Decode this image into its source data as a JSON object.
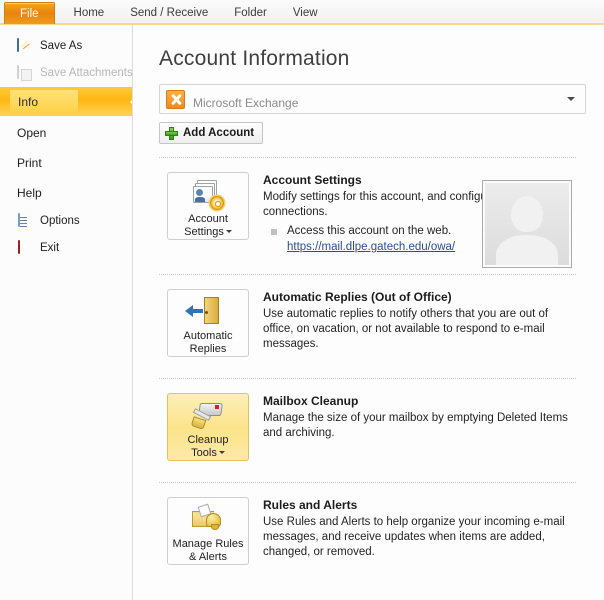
{
  "window": {
    "title": "Account Information"
  },
  "ribbon": {
    "tabs": [
      {
        "label": "File",
        "active": true
      },
      {
        "label": "Home",
        "active": false
      },
      {
        "label": "Send / Receive",
        "active": false
      },
      {
        "label": "Folder",
        "active": false
      },
      {
        "label": "View",
        "active": false
      }
    ]
  },
  "sidebar": {
    "items": [
      {
        "label": "Save As",
        "icon": "save-as-icon",
        "state": "normal"
      },
      {
        "label": "Save Attachments",
        "icon": "save-attachments-icon",
        "state": "disabled"
      },
      {
        "label": "Info",
        "icon": "",
        "state": "selected"
      },
      {
        "label": "Open",
        "icon": "",
        "state": "normal"
      },
      {
        "label": "Print",
        "icon": "",
        "state": "normal"
      },
      {
        "label": "Help",
        "icon": "",
        "state": "normal"
      },
      {
        "label": "Options",
        "icon": "options-icon",
        "state": "normal"
      },
      {
        "label": "Exit",
        "icon": "exit-icon",
        "state": "normal"
      }
    ]
  },
  "account": {
    "selected": "Microsoft Exchange",
    "icon": "exchange-icon",
    "add_button": "Add Account"
  },
  "sections": [
    {
      "button_label_line1": "Account",
      "button_label_line2": "Settings",
      "has_caret": true,
      "highlighted": false,
      "icon": "account-settings-icon",
      "heading": "Account Settings",
      "description": "Modify settings for this account, and configure additional connections.",
      "bullet": "Access this account on the web.",
      "link": "https://mail.dlpe.gatech.edu/owa/"
    },
    {
      "button_label_line1": "Automatic",
      "button_label_line2": "Replies",
      "has_caret": false,
      "highlighted": false,
      "icon": "automatic-replies-icon",
      "heading": "Automatic Replies (Out of Office)",
      "description": "Use automatic replies to notify others that you are out of office, on vacation, or not available to respond to e-mail messages."
    },
    {
      "button_label_line1": "Cleanup",
      "button_label_line2": "Tools",
      "has_caret": true,
      "highlighted": true,
      "icon": "cleanup-tools-icon",
      "heading": "Mailbox Cleanup",
      "description": "Manage the size of your mailbox by emptying Deleted Items and archiving."
    },
    {
      "button_label_line1": "Manage Rules",
      "button_label_line2": "& Alerts",
      "has_caret": false,
      "highlighted": false,
      "icon": "manage-rules-alerts-icon",
      "heading": "Rules and Alerts",
      "description": "Use Rules and Alerts to help organize your incoming e-mail messages, and receive updates when items are added, changed, or removed."
    }
  ],
  "avatar": {
    "name": "user-photo-placeholder"
  },
  "colors": {
    "accent_orange": "#e8840c",
    "selected_gold": "#fdb813",
    "highlight_amber": "#fbe38b",
    "link_blue": "#2a4f8f"
  }
}
